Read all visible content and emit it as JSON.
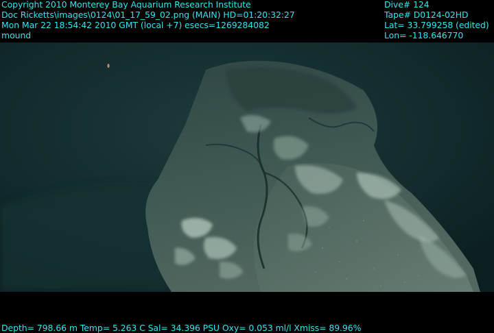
{
  "overlay": {
    "color": "#35e3ee",
    "left": {
      "line1": "Copyright 2010 Monterey Bay Aquarium Research Institute",
      "line2": "Doc Ricketts\\images\\0124\\01_17_59_02.png (MAIN)  HD=01:20:32:27",
      "line3": "Mon Mar 22 18:54:42 2010 GMT (local +7)  esecs=1269284082",
      "line4": "mound"
    },
    "right": {
      "dive": "Dive# 124",
      "tape": "Tape# D0124-02HD",
      "lat": "Lat= 33.799258 (edited)",
      "lon": "Lon= -118.646770"
    },
    "bottom": {
      "sensors": "Depth= 798.66 m  Temp= 5.263 C  Sal= 34.396 PSU  Oxy= 0.053 ml/l  Xmiss= 89.96%"
    }
  },
  "colors": {
    "water": "#0f2728",
    "rock": "#3c5651",
    "bacterial_mat": "#9fbcb2"
  }
}
